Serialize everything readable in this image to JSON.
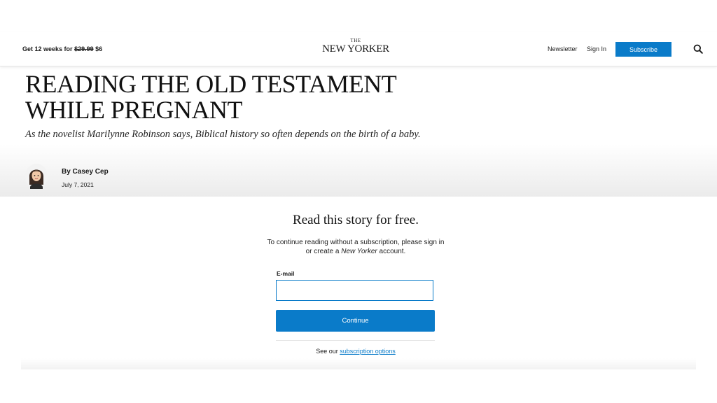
{
  "header": {
    "promo_prefix": "Get 12 weeks for",
    "promo_old_price": "$29.99",
    "promo_new_price": "$6",
    "logo_the": "THE",
    "logo_name": "NEW YORKER",
    "newsletter_label": "Newsletter",
    "signin_label": "Sign In",
    "subscribe_label": "Subscribe",
    "search_icon": "search-icon"
  },
  "article": {
    "headline": "READING THE OLD TESTAMENT WHILE PREGNANT",
    "dek": "As the novelist Marilynne Robinson says, Biblical history so often depends on the birth of a baby.",
    "byline": "By Casey Cep",
    "date": "July 7, 2021"
  },
  "paywall": {
    "title": "Read this story for free.",
    "text_before": "To continue reading without a subscription, please sign in or create a",
    "text_italic": "New Yorker",
    "text_after": "account.",
    "email_label": "E-mail",
    "email_value": "",
    "continue_label": "Continue",
    "see_prefix": "See our",
    "options_link": "subscription options"
  },
  "colors": {
    "accent": "#0a7bc9",
    "text": "#1a1a1a"
  }
}
